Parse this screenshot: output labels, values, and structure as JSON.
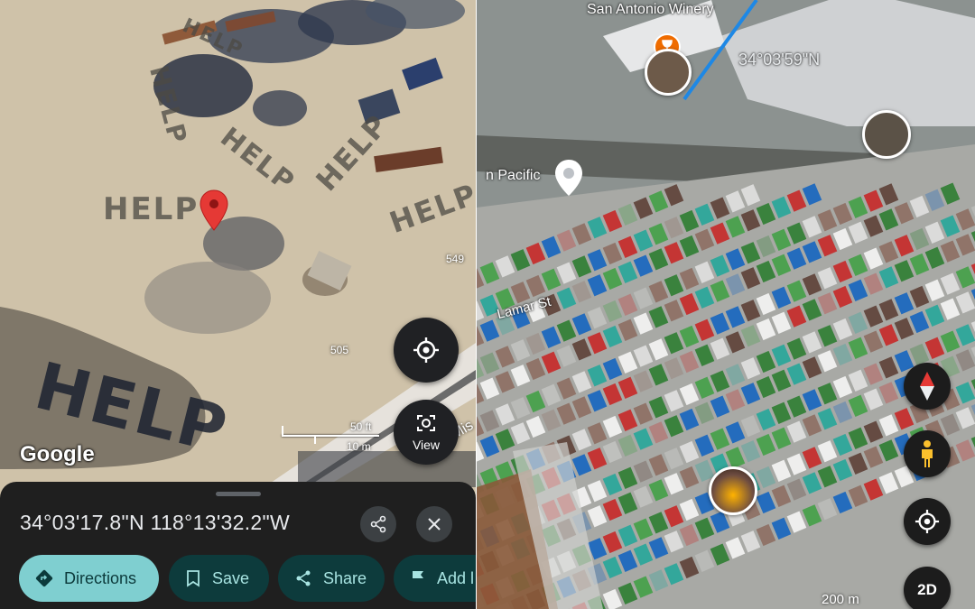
{
  "left_view": {
    "logo": "Google",
    "ground_markings": [
      "HELP",
      "HELP",
      "HELP",
      "HELP",
      "HELP",
      "HELP",
      "HELP"
    ],
    "road_labels": [
      "549",
      "505",
      "Mis"
    ],
    "scale": {
      "imperial": "50 ft",
      "metric": "10 m"
    },
    "view_button_label": "View",
    "colors": {
      "pin": "#e53935",
      "sheet_bg": "#1f1f1f",
      "chip_primary": "#7fcfd0"
    }
  },
  "place_sheet": {
    "coordinates": "34°03'17.8\"N 118°13'32.2\"W",
    "actions": [
      {
        "label": "Directions",
        "icon": "directions-icon"
      },
      {
        "label": "Save",
        "icon": "bookmark-icon"
      },
      {
        "label": "Share",
        "icon": "share-icon"
      },
      {
        "label": "Add l",
        "icon": "flag-icon"
      }
    ]
  },
  "right_view": {
    "labels": {
      "winery": "San Antonio Winery",
      "coord_overlay": "34°03'59\"N",
      "railroad": "n Pacific",
      "street": "Lamar St"
    },
    "scale": "200 m",
    "mode_button": "2D"
  }
}
